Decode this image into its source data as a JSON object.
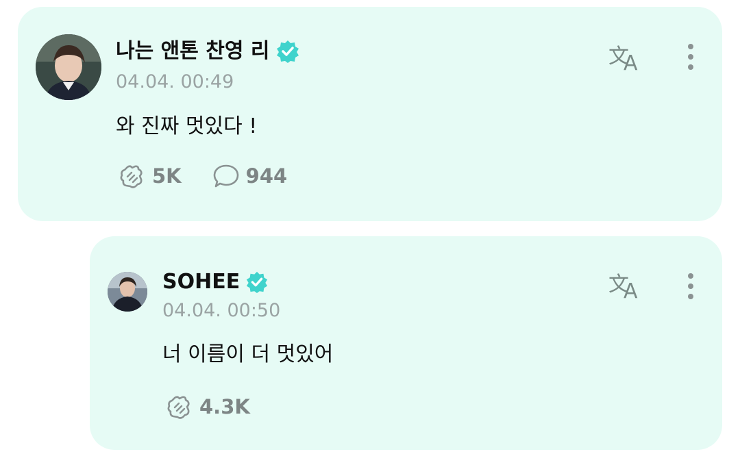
{
  "post": {
    "author": "나는 앤톤 찬영 리",
    "timestamp": "04.04. 00:49",
    "text": "와 진짜 멋있다 !",
    "likes": "5K",
    "comments": "944",
    "icons": {
      "translate": "translate-icon",
      "more": "more-vertical-icon",
      "like": "cheer-hand-icon",
      "comment": "comment-bubble-icon",
      "verified": "verified-badge-icon"
    }
  },
  "reply": {
    "author": "SOHEE",
    "timestamp": "04.04. 00:50",
    "text": "너 이름이 더 멋있어",
    "likes": "4.3K",
    "icons": {
      "translate": "translate-icon",
      "more": "more-vertical-icon",
      "like": "cheer-hand-icon",
      "verified": "verified-badge-icon"
    }
  },
  "colors": {
    "card_bg": "#e6fbf5",
    "accent": "#3fd3cc",
    "muted_text": "#9aa3a3",
    "icon_gray": "#8a9292"
  }
}
